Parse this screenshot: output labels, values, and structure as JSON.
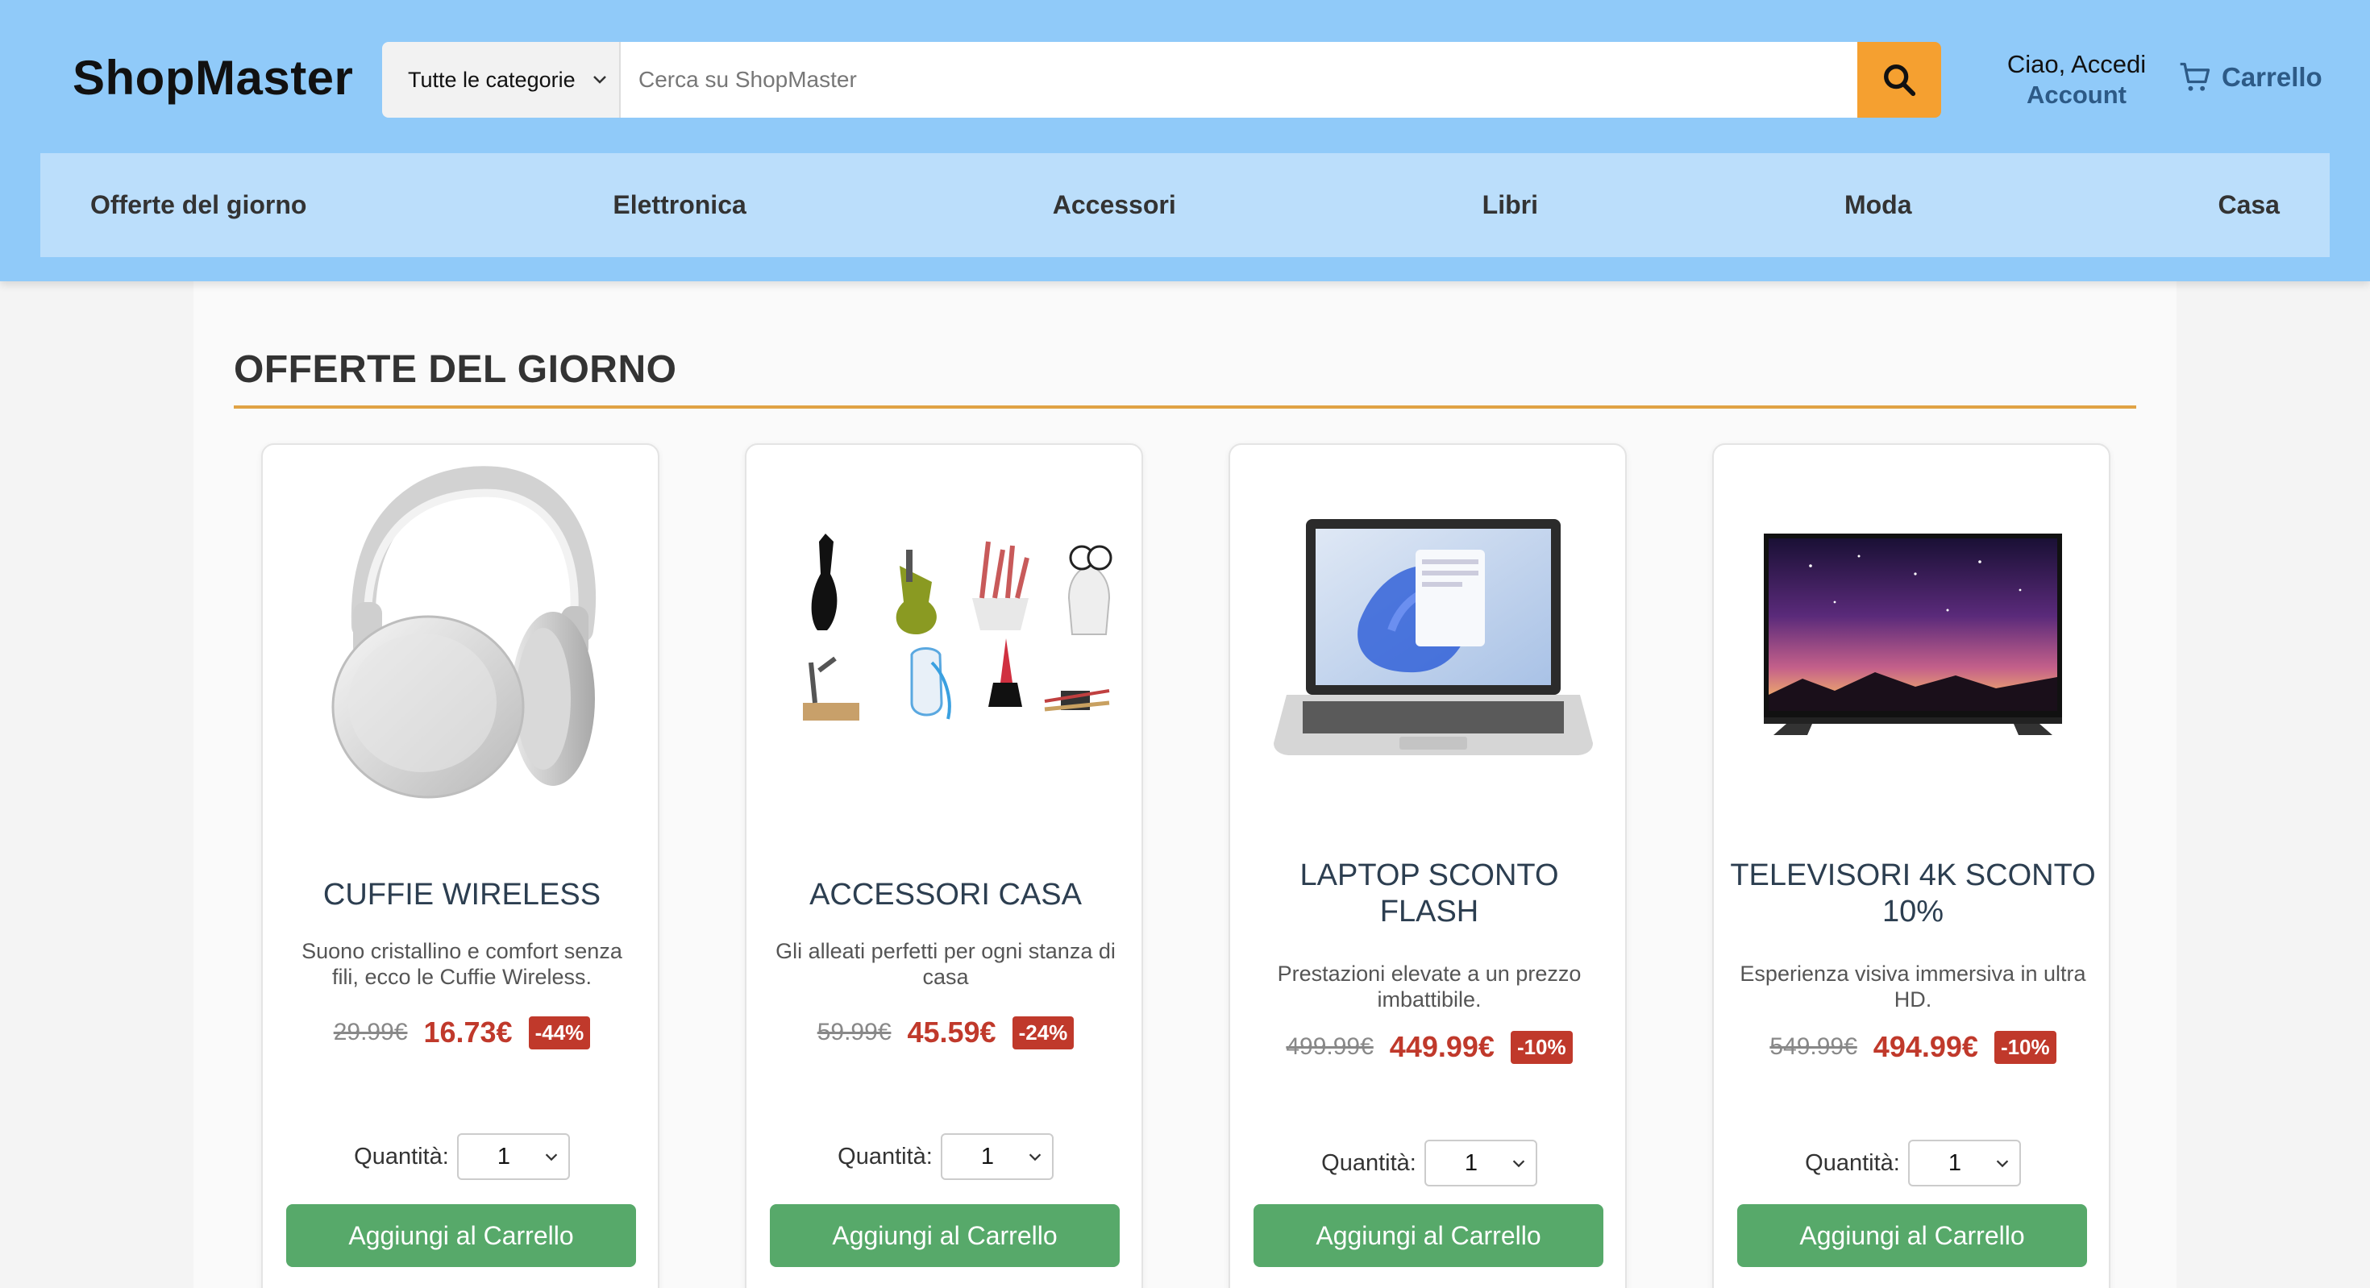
{
  "header": {
    "logo": "ShopMaster",
    "category_select": "Tutte le categorie",
    "search_placeholder": "Cerca su ShopMaster",
    "greeting": "Ciao, Accedi",
    "account": "Account",
    "cart": "Carrello",
    "accent_color": "#f5a030"
  },
  "nav": {
    "items": [
      "Offerte del giorno",
      "Elettronica",
      "Accessori",
      "Libri",
      "Moda",
      "Casa"
    ]
  },
  "section": {
    "title": "OFFERTE DEL GIORNO"
  },
  "products": [
    {
      "title": "CUFFIE WIRELESS",
      "description": "Suono cristallino e comfort senza fili, ecco le Cuffie Wireless.",
      "old_price": "29.99€",
      "new_price": "16.73€",
      "discount": "-44%",
      "qty_label": "Quantità:",
      "qty": "1",
      "button": "Aggiungi al Carrello",
      "image": "headphones"
    },
    {
      "title": "ACCESSORI CASA",
      "description": "Gli alleati perfetti per ogni stanza di casa",
      "old_price": "59.99€",
      "new_price": "45.59€",
      "discount": "-24%",
      "qty_label": "Quantità:",
      "qty": "1",
      "button": "Aggiungi al Carrello",
      "image": "kitchen-accessories"
    },
    {
      "title": "LAPTOP SCONTO FLASH",
      "description": "Prestazioni elevate a un prezzo imbattibile.",
      "old_price": "499.99€",
      "new_price": "449.99€",
      "discount": "-10%",
      "qty_label": "Quantità:",
      "qty": "1",
      "button": "Aggiungi al Carrello",
      "image": "laptop"
    },
    {
      "title": "TELEVISORI 4K SCONTO 10%",
      "description": "Esperienza visiva immersiva in ultra HD.",
      "old_price": "549.99€",
      "new_price": "494.99€",
      "discount": "-10%",
      "qty_label": "Quantità:",
      "qty": "1",
      "button": "Aggiungi al Carrello",
      "image": "television"
    }
  ]
}
